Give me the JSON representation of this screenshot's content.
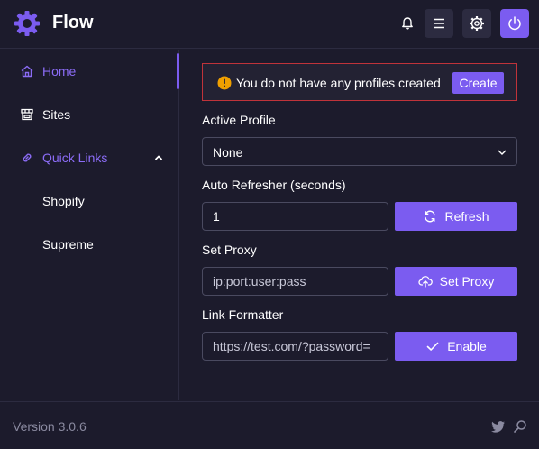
{
  "app": {
    "title": "Flow"
  },
  "colors": {
    "accent": "#7b5cf0",
    "background": "#1c1b2c",
    "alert_border": "#c0333a",
    "warning": "#f0a000"
  },
  "header": {
    "icons": [
      "logo-gear-icon",
      "bell-icon",
      "menu-icon",
      "settings-icon",
      "power-icon"
    ]
  },
  "sidebar": {
    "items": [
      {
        "label": "Home",
        "icon": "home-icon",
        "active": true
      },
      {
        "label": "Sites",
        "icon": "store-icon"
      },
      {
        "label": "Quick Links",
        "icon": "link-icon",
        "expanded": true
      },
      {
        "label": "Shopify"
      },
      {
        "label": "Supreme"
      }
    ]
  },
  "alert": {
    "message": "You do not have any profiles created",
    "button": "Create"
  },
  "form": {
    "active_profile": {
      "label": "Active Profile",
      "value": "None"
    },
    "auto_refresher": {
      "label": "Auto Refresher (seconds)",
      "value": "1",
      "button": "Refresh"
    },
    "set_proxy": {
      "label": "Set Proxy",
      "placeholder": "ip:port:user:pass",
      "button": "Set Proxy"
    },
    "link_formatter": {
      "label": "Link Formatter",
      "placeholder": "https://test.com/?password=",
      "button": "Enable"
    }
  },
  "footer": {
    "version": "Version 3.0.6",
    "icons": [
      "twitter-icon",
      "search-icon"
    ]
  }
}
